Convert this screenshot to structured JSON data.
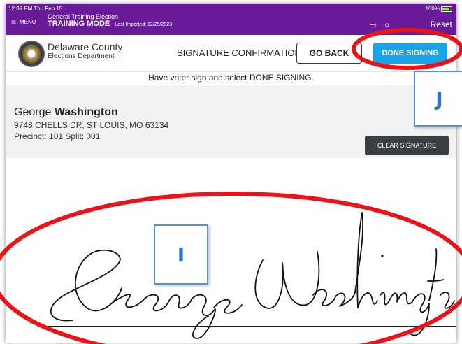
{
  "status_bar": {
    "time": "12:39 PM  Thu Feb 15",
    "battery": "100%",
    "menu_label": "MENU",
    "election_name": "General Training Election",
    "mode": "TRAINING MODE",
    "last_imported": "Last Imported: 12/25/2023",
    "reset_label": "Reset"
  },
  "header": {
    "county_name": "Delaware County",
    "department": "Elections Department",
    "title": "SIGNATURE CONFIRMATION",
    "go_back_label": "GO BACK",
    "done_label": "DONE SIGNING"
  },
  "instruction": "Have voter sign and select DONE SIGNING.",
  "voter": {
    "first_name": "George",
    "last_name": "Washington",
    "address": "9748 CHELLS DR, ST LOUIS, MO 63134",
    "precinct": "Precinct: 101 Split: 001",
    "clear_label": "CLEAR SIGNATURE"
  },
  "signature": {
    "mark": "×"
  },
  "annotations": {
    "label_j": "J",
    "label_i": "I",
    "color": "#e8141a"
  }
}
